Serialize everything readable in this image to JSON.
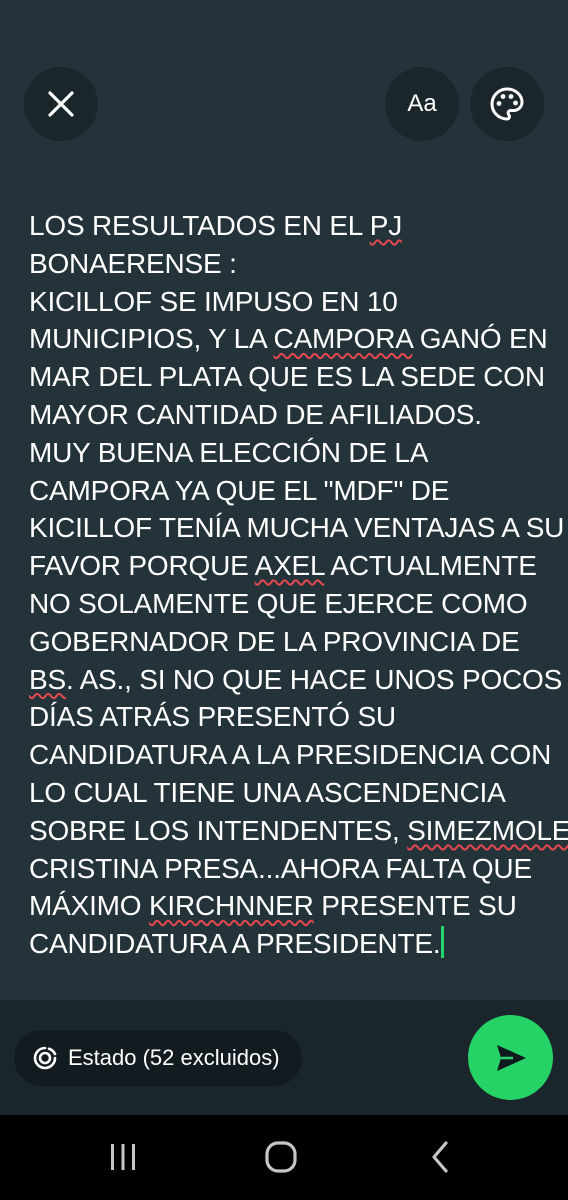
{
  "toolbar": {
    "close_icon": "close-icon",
    "font_label": "Aa",
    "palette_icon": "palette-icon"
  },
  "status": {
    "lines": [
      [
        "LOS RESULTADOS EN EL ",
        "PJ",
        ""
      ],
      [
        "BONAERENSE :"
      ],
      [
        "KICILLOF SE IMPUSO EN 10"
      ],
      [
        "MUNICIPIOS, Y LA ",
        "CAMPORA",
        " GANÓ EN"
      ],
      [
        "MAR DEL PLATA QUE ES LA SEDE CON"
      ],
      [
        "MAYOR CANTIDAD DE AFILIADOS."
      ],
      [
        "MUY BUENA ELECCIÓN DE LA"
      ],
      [
        "CAMPORA YA QUE EL \"MDF\" DE"
      ],
      [
        "KICILLOF TENÍA MUCHA VENTAJAS A SU"
      ],
      [
        "FAVOR PORQUE ",
        "AXEL",
        " ACTUALMENTE"
      ],
      [
        "NO SOLAMENTE QUE EJERCE COMO"
      ],
      [
        "GOBERNADOR  DE LA PROVINCIA DE"
      ],
      [
        "",
        "BS",
        ". AS., SI NO QUE HACE UNOS POCOS"
      ],
      [
        "DÍAS ATRÁS PRESENTÓ SU"
      ],
      [
        "CANDIDATURA A LA PRESIDENCIA CON"
      ],
      [
        "LO CUAL TIENE UNA ASCENDENCIA"
      ],
      [
        "SOBRE LOS INTENDENTES, ",
        "SIMEZMOLE",
        ""
      ],
      [
        "CRISTINA PRESA...AHORA FALTA QUE"
      ],
      [
        "MÁXIMO ",
        "KIRCHNNER",
        " PRESENTE SU"
      ],
      [
        "CANDIDATURA A PRESIDENTE."
      ]
    ],
    "colors": {
      "background": "#24323a",
      "text": "#ffffff",
      "spellcheck_underline": "#e5484d",
      "caret": "#25d366"
    }
  },
  "footer": {
    "audience_label": "Estado (52 excluidos)",
    "audience_icon": "status-ring-icon",
    "send_icon": "send-icon",
    "send_color": "#25d366"
  },
  "navigation": {
    "recents_icon": "recents-icon",
    "home_icon": "home-icon",
    "back_icon": "back-icon"
  }
}
